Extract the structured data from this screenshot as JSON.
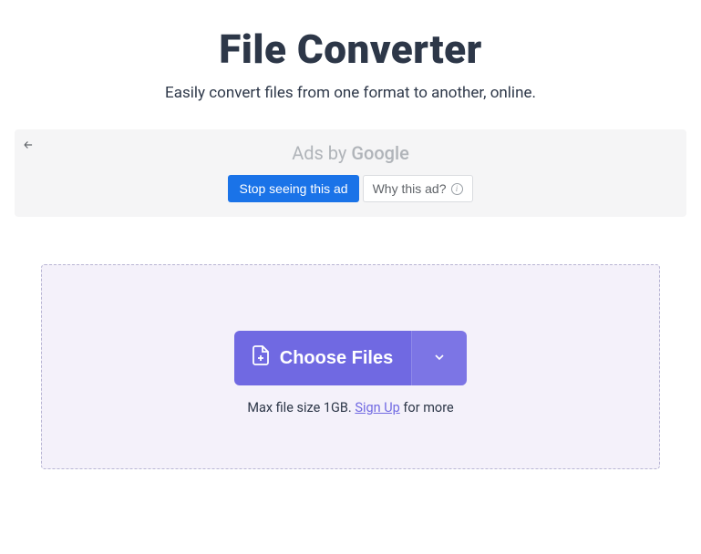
{
  "header": {
    "title": "File Converter",
    "subtitle": "Easily convert files from one format to another, online."
  },
  "ad": {
    "ads_by_prefix": "Ads by ",
    "ads_by_brand": "Google",
    "stop_seeing_label": "Stop seeing this ad",
    "why_ad_label": "Why this ad?"
  },
  "upload": {
    "choose_files_label": "Choose Files",
    "max_size_prefix": "Max file size 1GB. ",
    "signup_label": "Sign Up",
    "max_size_suffix": " for more"
  }
}
